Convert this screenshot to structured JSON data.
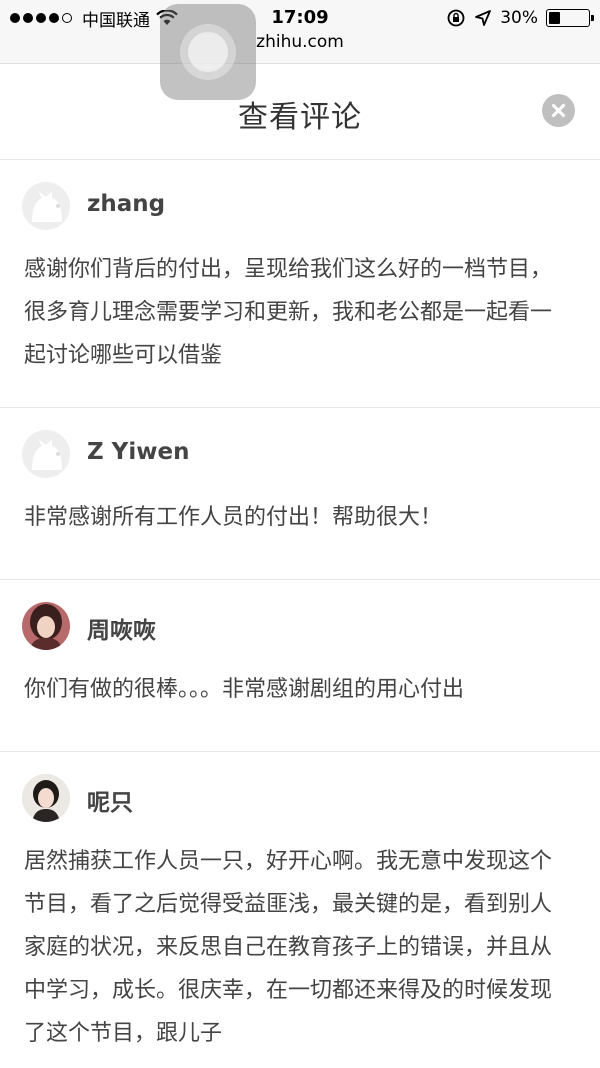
{
  "status_bar": {
    "carrier": "中国联通",
    "time": "17:09",
    "battery_percent": "30%",
    "battery_level": 0.3,
    "url": "zhihu.com"
  },
  "header": {
    "title": "查看评论",
    "close_icon": "close-icon"
  },
  "comments": [
    {
      "username": "zhang",
      "avatar": "default-avatar",
      "text": "感谢你们背后的付出，呈现给我们这么好的一档节目，很多育儿理念需要学习和更新，我和老公都是一起看一起讨论哪些可以借鉴"
    },
    {
      "username": "Z Yiwen",
      "avatar": "default-avatar",
      "text": "非常感谢所有工作人员的付出！帮助很大！"
    },
    {
      "username": "周咴咴",
      "avatar": "user-photo-avatar",
      "text": "你们有做的很棒。。。非常感谢剧组的用心付出"
    },
    {
      "username": "呢只",
      "avatar": "user-photo-avatar",
      "text": "居然捕获工作人员一只，好开心啊。我无意中发现这个节目，看了之后觉得受益匪浅，最关键的是，看到别人家庭的状况，来反思自己在教育孩子上的错误，并且从中学习，成长。很庆幸，在一切都还来得及的时候发现了这个节目，跟儿子"
    }
  ]
}
